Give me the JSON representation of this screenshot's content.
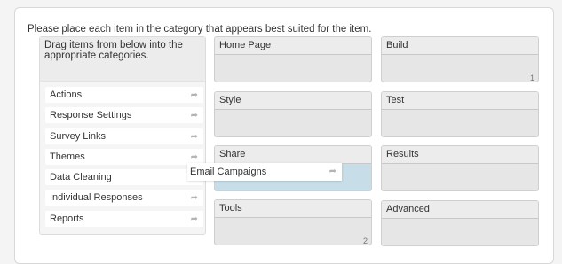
{
  "question": {
    "prompt": "Please place each item in the category that appears best suited for the item."
  },
  "bank": {
    "header": "Drag items from below into the appropriate categories.",
    "items": [
      {
        "label": "Actions"
      },
      {
        "label": "Response Settings"
      },
      {
        "label": "Survey Links"
      },
      {
        "label": "Themes"
      },
      {
        "label": "Data Cleaning"
      },
      {
        "label": "Individual Responses"
      },
      {
        "label": "Reports"
      }
    ],
    "item_icon": "share-arrow-icon"
  },
  "dragging": {
    "label": "Email Campaigns",
    "icon": "share-arrow-icon"
  },
  "groups": [
    {
      "label": "Home Page",
      "count": ""
    },
    {
      "label": "Build",
      "count": "1"
    },
    {
      "label": "Style",
      "count": ""
    },
    {
      "label": "Test",
      "count": ""
    },
    {
      "label": "Share",
      "count": ""
    },
    {
      "label": "Results",
      "count": ""
    },
    {
      "label": "Tools",
      "count": "2"
    },
    {
      "label": "Advanced",
      "count": ""
    }
  ],
  "colors": {
    "drop_highlight": "#c7dde7",
    "group_bg": "#e6e6e6",
    "bank_bg": "#f5f5f5"
  }
}
